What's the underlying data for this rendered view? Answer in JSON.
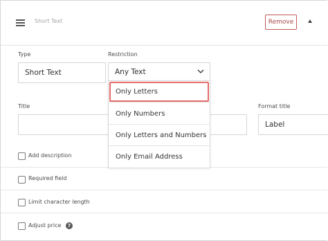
{
  "header": {
    "title": "Short Text",
    "remove_label": "Remove"
  },
  "type_field": {
    "label": "Type",
    "value": "Short Text"
  },
  "restriction_field": {
    "label": "Restriction",
    "value": "Any Text",
    "options": [
      "Only Letters",
      "Only Numbers",
      "Only Letters and Numbers",
      "Only Email Address"
    ],
    "highlighted": "Only Letters"
  },
  "title_field": {
    "label": "Title",
    "value": ""
  },
  "format_title_field": {
    "label": "Format title",
    "value": "Label"
  },
  "checkboxes": {
    "add_description": "Add description",
    "required_field": "Required field",
    "limit_character_length": "Limit character length",
    "adjust_price": "Adjust price"
  },
  "colors": {
    "remove_border": "#c15a5a",
    "highlight": "#e56b6b",
    "divider": "#e6e6e6"
  },
  "icons": {
    "drag": "hamburger-icon",
    "collapse": "triangle-up-icon",
    "select": "chevron-down-icon",
    "help": "question-icon"
  }
}
